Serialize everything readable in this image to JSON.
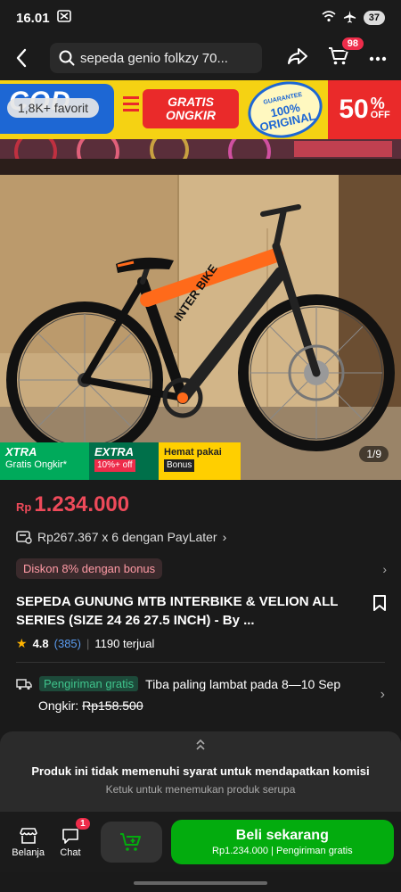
{
  "status": {
    "time": "16.01",
    "battery": "37"
  },
  "nav": {
    "search_text": "sepeda genio folkzy 70...",
    "cart_count": "98"
  },
  "banner": {
    "cod": "COD",
    "favorites": "1,8K+ favorit",
    "gratis_line1": "GRATIS",
    "gratis_line2": "ONGKIR",
    "seal_top": "GUARANTEE",
    "seal_line1": "100%",
    "seal_line2": "ORIGINAL",
    "off_num": "50",
    "off_pct": "%",
    "off_label": "OFF"
  },
  "image": {
    "counter": "1/9",
    "frame_text": "INTER BIKE"
  },
  "promo_strip": {
    "xtra_title": "XTRA",
    "xtra_sub": "Gratis Ongkir*",
    "extra_title": "EXTRA",
    "extra_tag": "10%+ off",
    "hemat_title": "Hemat pakai",
    "hemat_tag": "Bonus"
  },
  "product": {
    "currency": "Rp",
    "price": "1.234.000",
    "paylater": "Rp267.367 x 6 dengan PayLater",
    "discount": "Diskon 8% dengan bonus",
    "title": "SEPEDA GUNUNG MTB INTERBIKE & VELION ALL SERIES (SIZE 24 26 27.5 INCH) - By  ...",
    "rating": "4.8",
    "rating_count": "(385)",
    "sold": "1190 terjual"
  },
  "shipping": {
    "tag": "Pengiriman gratis",
    "eta": "Tiba paling lambat pada 8—10 Sep",
    "ongkir_label": "Ongkir:",
    "ongkir_old": "Rp158.500"
  },
  "commission": {
    "title": "Produk ini tidak memenuhi syarat untuk mendapatkan komisi",
    "sub": "Ketuk untuk menemukan produk serupa"
  },
  "bottom": {
    "shop_label": "Belanja",
    "chat_label": "Chat",
    "chat_badge": "1",
    "buy_label": "Beli sekarang",
    "buy_sub": "Rp1.234.000 | Pengiriman gratis"
  }
}
